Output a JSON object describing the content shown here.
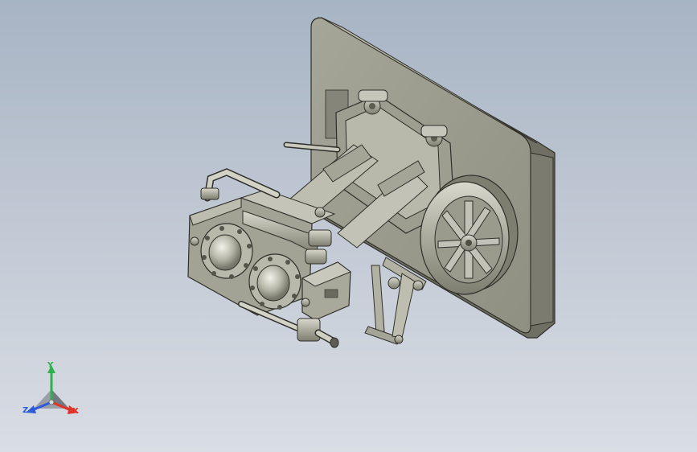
{
  "viewport": {
    "background_top": "#a7b4c4",
    "background_bottom": "#d9dde4",
    "model_color": "#a9a99c"
  },
  "triad": {
    "y_label": "Y",
    "z_label": "Z",
    "x_label": "X",
    "y_color": "#2bb24c",
    "z_color": "#2f5bd9",
    "x_color": "#e0342b"
  }
}
